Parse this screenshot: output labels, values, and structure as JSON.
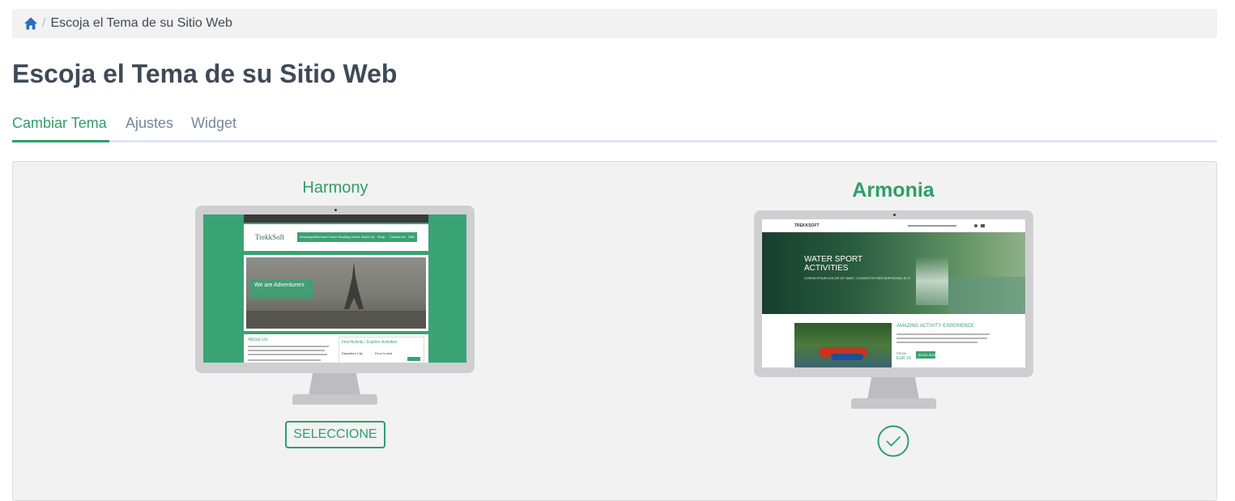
{
  "breadcrumb": {
    "current": "Escoja el Tema de su Sitio Web"
  },
  "page": {
    "title": "Escoja el Tema de su Sitio Web"
  },
  "tabs": [
    {
      "label": "Cambiar Tema",
      "active": true
    },
    {
      "label": "Ajustes",
      "active": false
    },
    {
      "label": "Widget",
      "active": false
    }
  ],
  "themes": [
    {
      "name": "Harmony",
      "action_label": "SELECCIONE",
      "selected": false,
      "preview": {
        "logo": "TrekkSoft",
        "nav": [
          "Amazing Adventure Home",
          "Booking Home",
          "About Us",
          "Shop",
          "Contact Us",
          "Wiki"
        ],
        "hero_title": "We are Adventurers",
        "about_title": "About Us",
        "find_title_a": "Find Activity",
        "find_sep": " / ",
        "find_title_b": "Explore Activities",
        "departure_label": "Departure City",
        "price_label": "It's a Crowd"
      }
    },
    {
      "name": "Armonia",
      "action_label": "",
      "selected": true,
      "preview": {
        "logo": "TREKKSOFT",
        "hero_line1": "WATER SPORT",
        "hero_line2": "ACTIVITIES",
        "hero_sub": "LOREM IPSUM DOLOR SIT AMET, CONSECTETUER ADIPISCING ELIT.",
        "section_title": "AMAZING ACTIVITY EXPERIENCE",
        "from_label": "FROM",
        "price": "EUR 19",
        "book_label": "BOOK NOW"
      }
    }
  ],
  "colors": {
    "accent": "#2f9e6a",
    "title": "#3f4a57",
    "tab_inactive": "#77869a"
  }
}
